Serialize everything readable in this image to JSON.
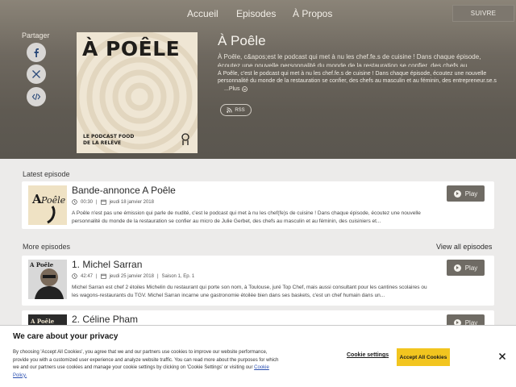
{
  "nav": {
    "home": "Accueil",
    "episodes": "Episodes",
    "about": "À Propos",
    "follow": "SUIVRE"
  },
  "share": {
    "label": "Partager",
    "buttons": [
      "facebook-icon",
      "x-icon",
      "embed-icon"
    ]
  },
  "cover": {
    "title": "À POÊLE",
    "subtitle_line1": "LE PODCAST FOOD",
    "subtitle_line2": "DE LA RELÈVE"
  },
  "show": {
    "title": "À Poêle",
    "description_short": "À Poêle, c&apos;est le podcast qui met à nu les chef.fe.s de cuisine ! Dans chaque épisode, écoutez une nouvelle personnalité du monde de la restauration se confier, des chefs au...",
    "description_long": "À Poêle, c'est le podcast qui met à nu les chef.fe.s de cuisine ! Dans chaque épisode, écoutez une nouvelle personnalité du monde de la restauration se confier, des chefs au masculin et au féminin, des entrepreneur.se.s",
    "more": "...Plus",
    "rss": "RSS"
  },
  "latest": {
    "label": "Latest episode",
    "title": "Bande-annonce A Poêle",
    "duration": "00:30",
    "date": "jeudi 18 janvier 2018",
    "description": "A Poêle n'est pas une émission qui parle de nudité, c'est le podcast qui met à nu les chef(fe)s de cuisine ! Dans chaque épisode, écoutez une nouvelle personnalité du monde de la restauration se confier au micro de Julie Gerbet, des chefs au masculin et au féminin, des cuisiniers et...",
    "play": "Play"
  },
  "more": {
    "label": "More episodes",
    "view_all": "View all episodes",
    "episodes": [
      {
        "title": "1. Michel Sarran",
        "duration": "42:47",
        "date": "jeudi 25 janvier 2018",
        "season": "Saison 1, Ep. 1",
        "description": "Michel Sarran est chef 2 étoiles Michelin du restaurant qui porte son nom, à Toulouse, juré Top Chef, mais aussi consultant pour les cantines scolaires ou les wagons-restaurants du TGV. Michel Sarran incarne une gastronomie étoilée bien dans ses baskets, c'est un chef humain dans un...",
        "play": "Play"
      },
      {
        "title": "2. Céline Pham",
        "play": "Play"
      }
    ]
  },
  "cookie": {
    "title": "We care about your privacy",
    "text": "By choosing 'Accept All Cookies', you agree that we and our partners use cookies to improve our website performance, provide you with a customized user experience and analyze website traffic. You can read more about the purposes for which we and our partners use cookies and manage your cookie settings by clicking on 'Cookie Settings' or visiting our",
    "link": "Cookie Policy.",
    "settings": "Cookie settings",
    "accept": "Accept All Cookies"
  }
}
